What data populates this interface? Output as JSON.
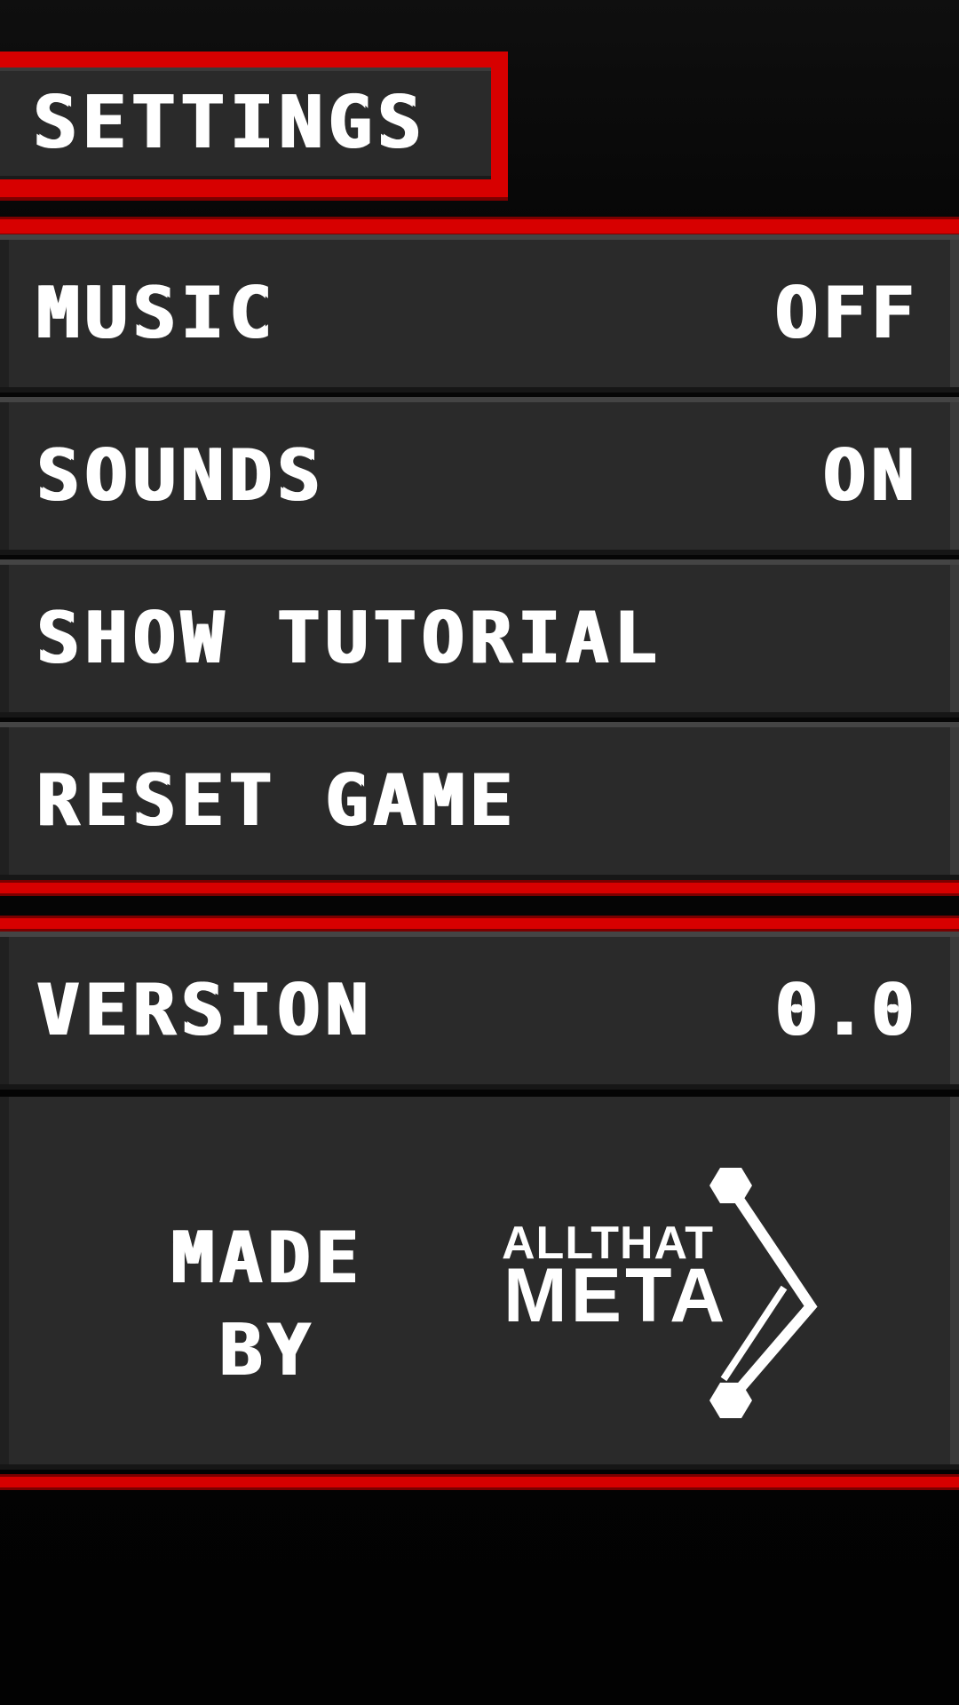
{
  "header": {
    "title": "SETTINGS"
  },
  "settings": {
    "music": {
      "label": "MUSIC",
      "value": "OFF"
    },
    "sounds": {
      "label": "SOUNDS",
      "value": "ON"
    },
    "tutorial": {
      "label": "SHOW TUTORIAL"
    },
    "reset": {
      "label": "RESET GAME"
    }
  },
  "info": {
    "version": {
      "label": "VERSION",
      "value": "0.0"
    }
  },
  "credits": {
    "made_by_line1": "MADE",
    "made_by_line2": "BY",
    "logo_top": "ALLTHAT",
    "logo_bottom": "META"
  },
  "colors": {
    "accent_red": "#d70000",
    "panel": "#2a2a2a",
    "text": "#ffffff"
  }
}
